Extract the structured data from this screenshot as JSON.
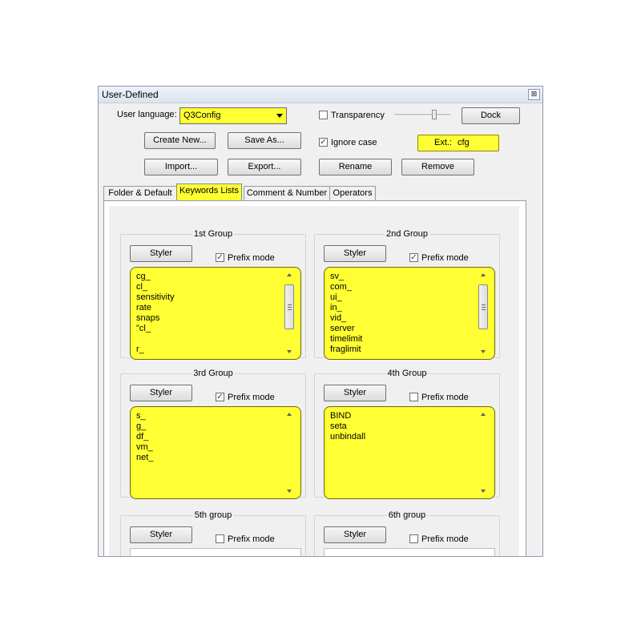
{
  "window": {
    "title": "User-Defined",
    "close_glyph": "⊠"
  },
  "top": {
    "user_language_label": "User language:",
    "user_language_value": "Q3Config",
    "transparency_label": "Transparency",
    "transparency_checked": false,
    "dock_label": "Dock",
    "create_new_label": "Create New...",
    "save_as_label": "Save As...",
    "ignore_case_label": "Ignore case",
    "ignore_case_checked": true,
    "ext_label": "Ext.:",
    "ext_value": "cfg",
    "import_label": "Import...",
    "export_label": "Export...",
    "rename_label": "Rename",
    "remove_label": "Remove"
  },
  "tabs": [
    {
      "label": "Folder & Default",
      "active": false
    },
    {
      "label": "Keywords Lists",
      "active": true
    },
    {
      "label": "Comment & Number",
      "active": false
    },
    {
      "label": "Operators",
      "active": false
    }
  ],
  "groups": [
    {
      "title": "1st Group",
      "styler": "Styler",
      "prefix_label": "Prefix mode",
      "prefix_checked": true,
      "items": [
        "cg_",
        "cl_",
        "sensitivity",
        "rate",
        "snaps",
        "\"cl_",
        "",
        "r_"
      ],
      "scroll_thumb": true
    },
    {
      "title": "2nd Group",
      "styler": "Styler",
      "prefix_label": "Prefix mode",
      "prefix_checked": true,
      "items": [
        "sv_",
        "com_",
        "ui_",
        "in_",
        "vid_",
        "server",
        "timelimit",
        "fraglimit"
      ],
      "scroll_thumb": true
    },
    {
      "title": "3rd Group",
      "styler": "Styler",
      "prefix_label": "Prefix mode",
      "prefix_checked": true,
      "items": [
        "s_",
        "g_",
        "df_",
        "vm_",
        "net_"
      ],
      "scroll_thumb": false
    },
    {
      "title": "4th Group",
      "styler": "Styler",
      "prefix_label": "Prefix mode",
      "prefix_checked": false,
      "items": [
        "BIND",
        "seta",
        "unbindall"
      ],
      "scroll_thumb": false
    },
    {
      "title": "5th group",
      "styler": "Styler",
      "prefix_label": "Prefix mode",
      "prefix_checked": false,
      "items": [],
      "scroll_thumb": false
    },
    {
      "title": "6th group",
      "styler": "Styler",
      "prefix_label": "Prefix mode",
      "prefix_checked": false,
      "items": [],
      "scroll_thumb": false
    }
  ],
  "colors": {
    "highlight": "#ffff33",
    "window_bg": "#f0f0f0"
  }
}
